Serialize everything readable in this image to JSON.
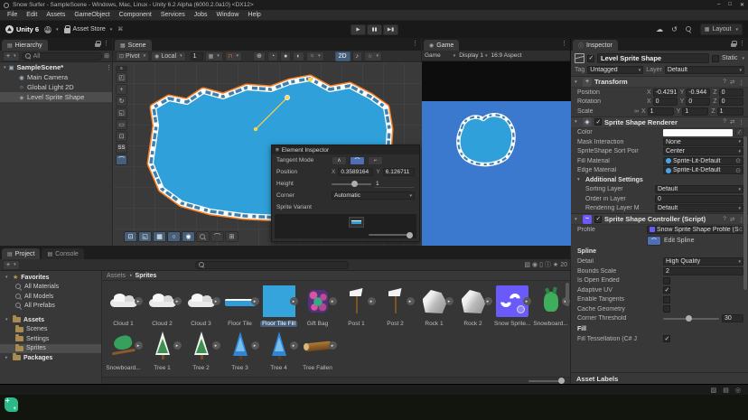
{
  "window": {
    "title": "Snow Surfer - SampleScene - Windows, Mac, Linux - Unity 6.2 Alpha (6000.2.0a10) <DX12>",
    "min": "–",
    "max": "□",
    "close": "✕"
  },
  "menus": [
    {
      "label": "File"
    },
    {
      "label": "Edit"
    },
    {
      "label": "Assets"
    },
    {
      "label": "GameObject"
    },
    {
      "label": "Component"
    },
    {
      "label": "Services"
    },
    {
      "label": "Jobs"
    },
    {
      "label": "Window"
    },
    {
      "label": "Help"
    }
  ],
  "toolbar": {
    "brand": "Unity 6",
    "account": "AN",
    "store": "Asset Store",
    "layout": "Layout"
  },
  "hierarchy": {
    "tab": "Hierarchy",
    "search_placeholder": "All",
    "scene_label": "SampleScene*",
    "children": [
      {
        "label": "Main Camera",
        "icon": "camera"
      },
      {
        "label": "Global Light 2D",
        "icon": "light"
      },
      {
        "label": "Level Sprite Shape",
        "icon": "sprite",
        "selected": true
      }
    ]
  },
  "scene": {
    "tab": "Scene",
    "pivot": "Pivot",
    "space": "Local",
    "grid_size": "1",
    "mode_2d": "2D",
    "custom_tool": "SS"
  },
  "element_inspector": {
    "title": "Element Inspector",
    "tangent_mode_label": "Tangent Mode",
    "position_label": "Position",
    "x_label": "X",
    "x_value": "0.3589164",
    "y_label": "Y",
    "y_value": "6.126711",
    "height_label": "Height",
    "height_value": "1",
    "corner_label": "Corner",
    "corner_value": "Automatic",
    "sprite_variant_label": "Sprite Variant"
  },
  "game": {
    "tab": "Game",
    "mode": "Game",
    "display": "Display 1",
    "aspect": "16:9 Aspect"
  },
  "inspector": {
    "tab": "Inspector",
    "name": "Level Sprite Shape",
    "static_label": "Static",
    "tag_label": "Tag",
    "tag_value": "Untagged",
    "layer_label": "Layer",
    "layer_value": "Default",
    "axis": {
      "x": "X",
      "y": "Y",
      "z": "Z"
    },
    "transform": {
      "title": "Transform",
      "position_label": "Position",
      "rotation_label": "Rotation",
      "scale_label": "Scale",
      "position": {
        "x": "-0.4291",
        "y": "-0.944",
        "z": "0"
      },
      "rotation": {
        "x": "0",
        "y": "0",
        "z": "0"
      },
      "scale": {
        "x": "1",
        "y": "1",
        "z": "1"
      }
    },
    "renderer": {
      "title": "Sprite Shape Renderer",
      "color_label": "Color",
      "mask_label": "Mask Interaction",
      "mask_value": "None",
      "sort_label": "SpriteShape Sort Poir",
      "sort_value": "Center",
      "fill_material_label": "Fill Material",
      "fill_material": "Sprite-Lit-Default",
      "edge_material_label": "Edge Material",
      "edge_material": "Sprite-Lit-Default",
      "additional_label": "Additional Settings",
      "sorting_layer_label": "Sorting Layer",
      "sorting_layer": "Default",
      "order_label": "Order in Layer",
      "order_value": "0",
      "rendering_layer_label": "Rendering Layer M",
      "rendering_layer": "Default"
    },
    "controller": {
      "title": "Sprite Shape Controller (Script)",
      "profile_label": "Profile",
      "profile_value": "Snow Sprite Shape Profile (S",
      "edit_spline": "Edit Spline",
      "spline_header": "Spline",
      "detail_label": "Detail",
      "detail_value": "High Quality",
      "bounds_label": "Bounds Scale",
      "bounds_value": "2",
      "open_ended_label": "Is Open Ended",
      "adaptive_label": "Adaptive UV",
      "tangents_label": "Enable Tangents",
      "cache_label": "Cache Geometry",
      "threshold_label": "Corner Threshold",
      "threshold_value": "30",
      "fill_header": "Fill",
      "tessellation_label": "Fill Tessellation (C# J"
    },
    "asset_labels": "Asset Labels"
  },
  "project": {
    "tab": "Project",
    "console_tab": "Console",
    "count_badge": "20",
    "tree": {
      "favorites": "Favorites",
      "fav_items": [
        {
          "label": "All Materials"
        },
        {
          "label": "All Models"
        },
        {
          "label": "All Prefabs"
        }
      ],
      "assets": "Assets",
      "folders": [
        {
          "label": "Scenes"
        },
        {
          "label": "Settings"
        },
        {
          "label": "Sprites",
          "selected": true
        }
      ],
      "packages": "Packages"
    },
    "breadcrumb": {
      "root": "Assets",
      "current": "Sprites"
    },
    "assets": [
      {
        "name": "Cloud 1",
        "kind": "cloud"
      },
      {
        "name": "Cloud 2",
        "kind": "cloud"
      },
      {
        "name": "Cloud 3",
        "kind": "cloud"
      },
      {
        "name": "Floor Tile",
        "kind": "floor"
      },
      {
        "name": "Floor Tile Fill",
        "kind": "fill",
        "selected": true
      },
      {
        "name": "Gift Bag",
        "kind": "gift"
      },
      {
        "name": "Post 1",
        "kind": "post"
      },
      {
        "name": "Post 2",
        "kind": "post"
      },
      {
        "name": "Rock 1",
        "kind": "rock"
      },
      {
        "name": "Rock 2",
        "kind": "rock"
      },
      {
        "name": "Snow Sprite...",
        "kind": "profile"
      },
      {
        "name": "Snowboard...",
        "kind": "character"
      },
      {
        "name": "Snowboard...",
        "kind": "character2"
      },
      {
        "name": "Tree 1",
        "kind": "tree-snow"
      },
      {
        "name": "Tree 2",
        "kind": "tree-snow"
      },
      {
        "name": "Tree 3",
        "kind": "tree-blue"
      },
      {
        "name": "Tree 4",
        "kind": "tree-blue"
      },
      {
        "name": "Tree Fallen",
        "kind": "log"
      }
    ]
  },
  "colors": {
    "sprite_fill": "#2fa0d9",
    "sprite_edge": "#1a6ba3",
    "selection_outline": "#ff7f1f",
    "sky": "#3a79ce",
    "profile_purple": "#6a5af9",
    "selection_blue": "#46607c",
    "point_yellow": "#ffd24a"
  }
}
